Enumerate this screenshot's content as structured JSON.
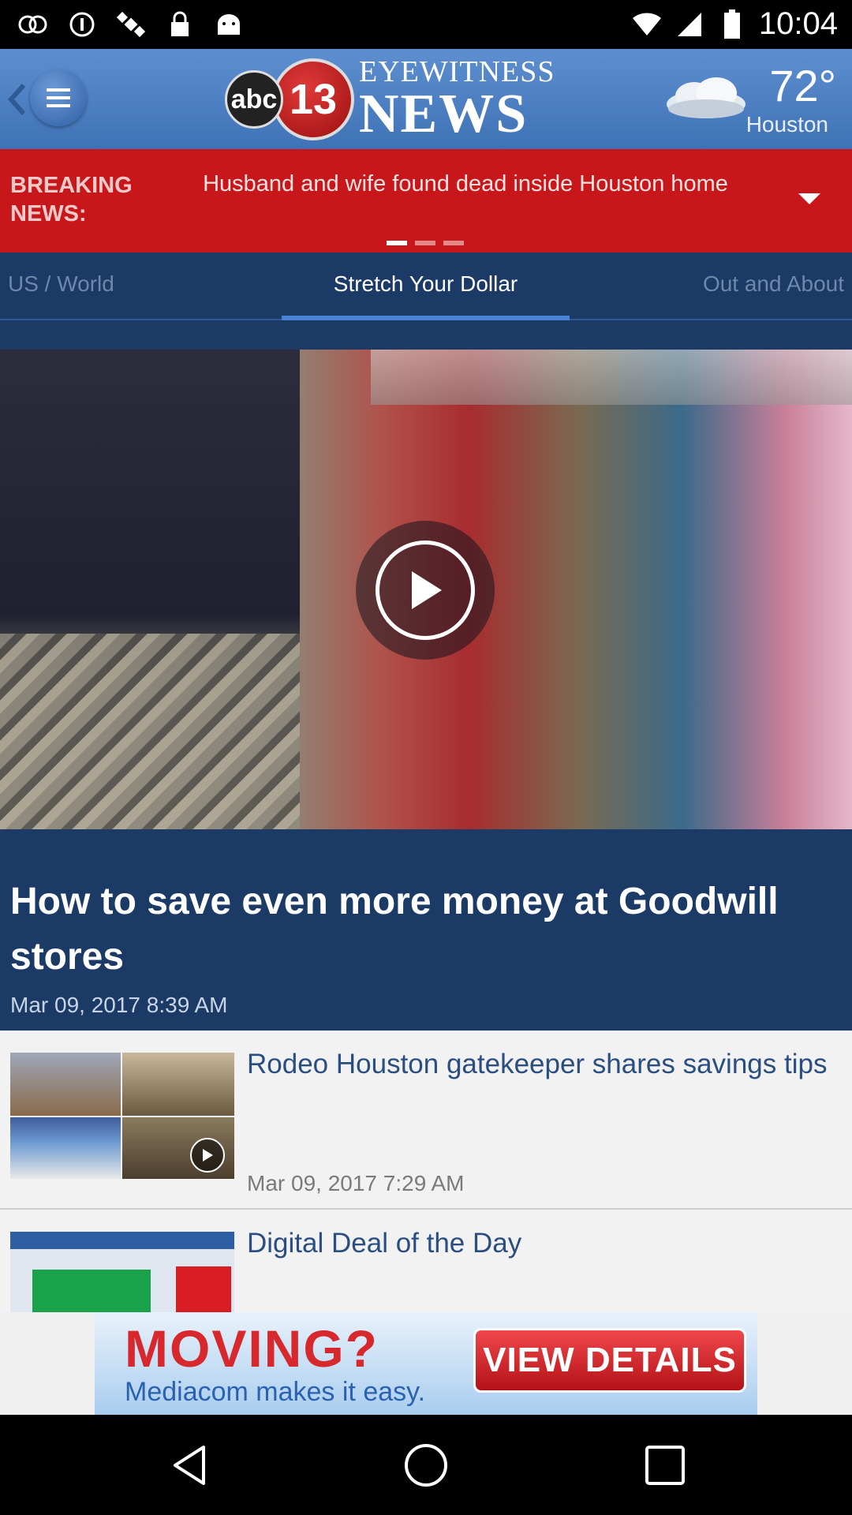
{
  "status_bar": {
    "time": "10:04",
    "icons": [
      "abc13-notification-icon",
      "info-icon",
      "satellite-icon",
      "lock-icon",
      "android-icon",
      "wifi-icon",
      "signal-icon",
      "battery-icon"
    ]
  },
  "header": {
    "logo": {
      "abc": "abc",
      "number": "13",
      "eyewitness": "EYEWITNESS",
      "news": "NEWS"
    },
    "weather": {
      "temp": "72°",
      "city": "Houston",
      "icon": "cloud-icon"
    }
  },
  "breaking": {
    "label": "BREAKING NEWS:",
    "headline": "Husband and wife found dead inside Houston home",
    "pages": 3,
    "active_page": 1
  },
  "tabs": [
    {
      "label": "US / World",
      "active": false
    },
    {
      "label": "Stretch Your Dollar",
      "active": true
    },
    {
      "label": "Out and About",
      "active": false
    }
  ],
  "hero": {
    "title": "How to save even more money at Goodwill stores",
    "date": "Mar 09, 2017 8:39 AM"
  },
  "list": [
    {
      "title": "Rodeo Houston gatekeeper shares savings tips",
      "date": "Mar 09, 2017 7:29 AM",
      "has_video": true
    },
    {
      "title": "Digital Deal of the Day",
      "date": ""
    }
  ],
  "ad": {
    "headline": "MOVING?",
    "sub": "Mediacom makes it easy.",
    "button": "VIEW DETAILS"
  },
  "colors": {
    "header_blue": "#4a7dc2",
    "breaking_red": "#c8171b",
    "page_navy": "#1b3a66",
    "tab_underline": "#4a83d6"
  }
}
